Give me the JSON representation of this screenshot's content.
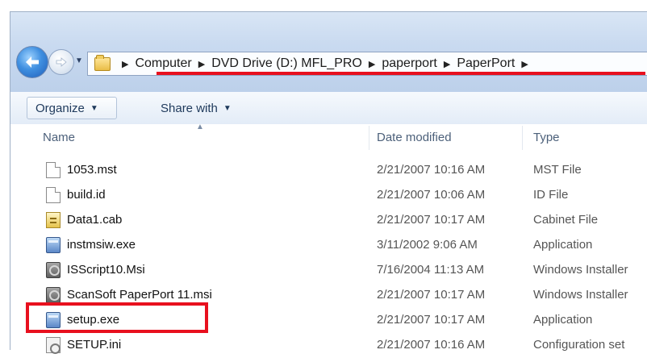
{
  "address_bar": {
    "crumbs": [
      "Computer",
      "DVD Drive (D:) MFL_PRO",
      "paperport",
      "PaperPort"
    ]
  },
  "toolbar": {
    "organize_label": "Organize",
    "share_label": "Share with"
  },
  "columns": {
    "name": "Name",
    "date": "Date modified",
    "type": "Type"
  },
  "files": [
    {
      "name": "1053.mst",
      "date": "2/21/2007 10:16 AM",
      "type": "MST File",
      "icon": "document-icon"
    },
    {
      "name": "build.id",
      "date": "2/21/2007 10:06 AM",
      "type": "ID File",
      "icon": "document-icon"
    },
    {
      "name": "Data1.cab",
      "date": "2/21/2007 10:17 AM",
      "type": "Cabinet File",
      "icon": "cabinet-icon"
    },
    {
      "name": "instmsiw.exe",
      "date": "3/11/2002 9:06 AM",
      "type": "Application",
      "icon": "application-icon"
    },
    {
      "name": "ISScript10.Msi",
      "date": "7/16/2004 11:13 AM",
      "type": "Windows Installer",
      "icon": "installer-icon"
    },
    {
      "name": "ScanSoft PaperPort 11.msi",
      "date": "2/21/2007 10:17 AM",
      "type": "Windows Installer",
      "icon": "installer-icon"
    },
    {
      "name": "setup.exe",
      "date": "2/21/2007 10:17 AM",
      "type": "Application",
      "icon": "application-icon"
    },
    {
      "name": "SETUP.ini",
      "date": "2/21/2007 10:16 AM",
      "type": "Configuration set",
      "icon": "settings-file-icon"
    }
  ],
  "colors": {
    "highlight_red": "#e8101e",
    "toolbar_text": "#1e395b"
  }
}
